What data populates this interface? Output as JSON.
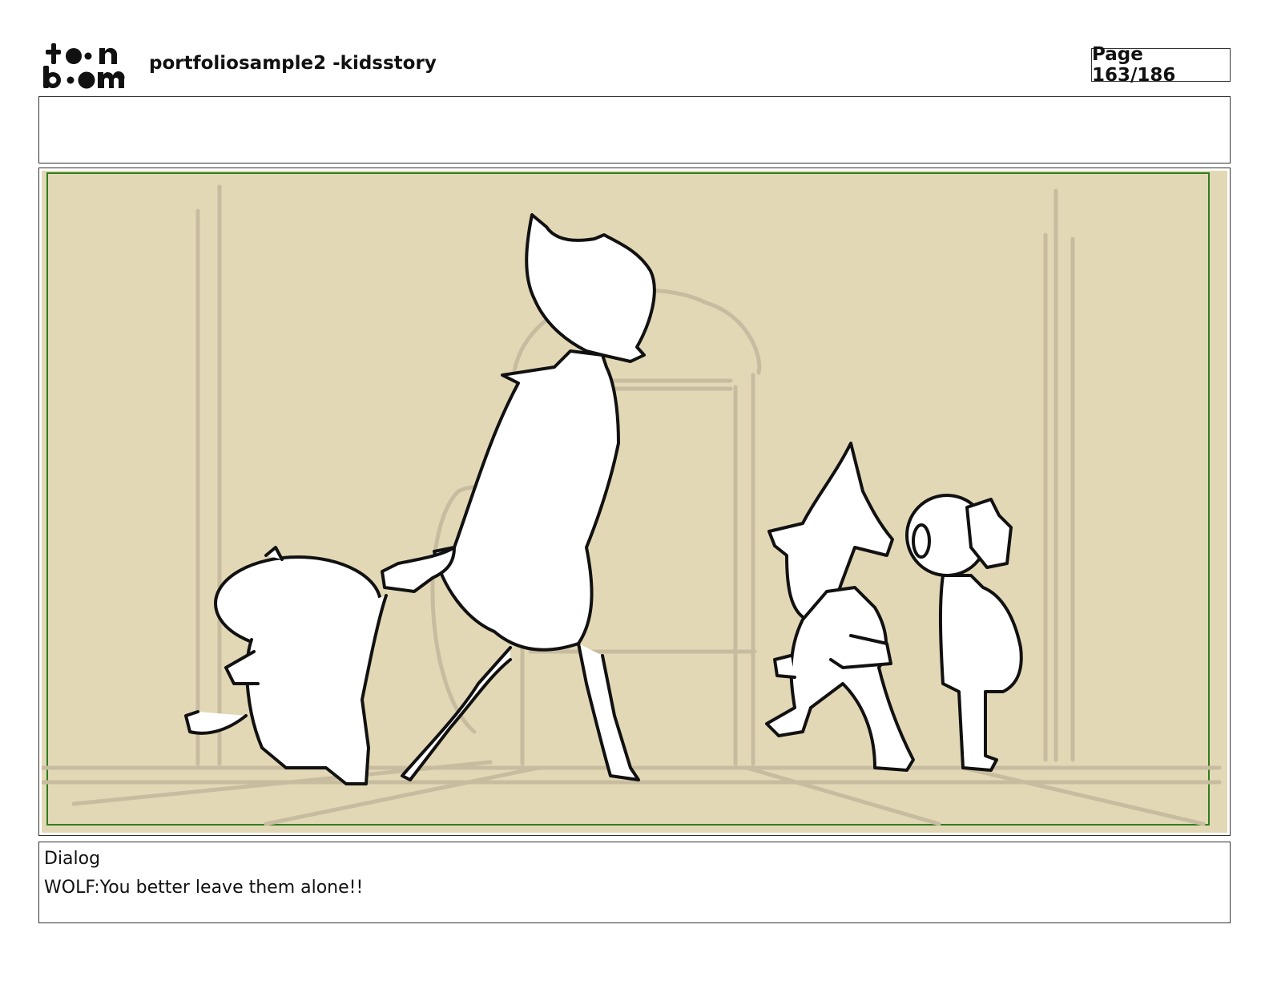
{
  "brand": {
    "logo_text_top": "toon",
    "logo_text_bottom": "boom",
    "logo_icon": "toonboom-logo-icon"
  },
  "document": {
    "title": "portfoliosample2 -kidsstory",
    "page_label": "Page 163/186"
  },
  "panel": {
    "frame_color": "#2e7d1f",
    "background_color": "#e3d8b6",
    "sketch_color": "#c8bca0"
  },
  "dialog": {
    "heading": "Dialog",
    "text": "WOLF:You better leave them alone!!"
  }
}
